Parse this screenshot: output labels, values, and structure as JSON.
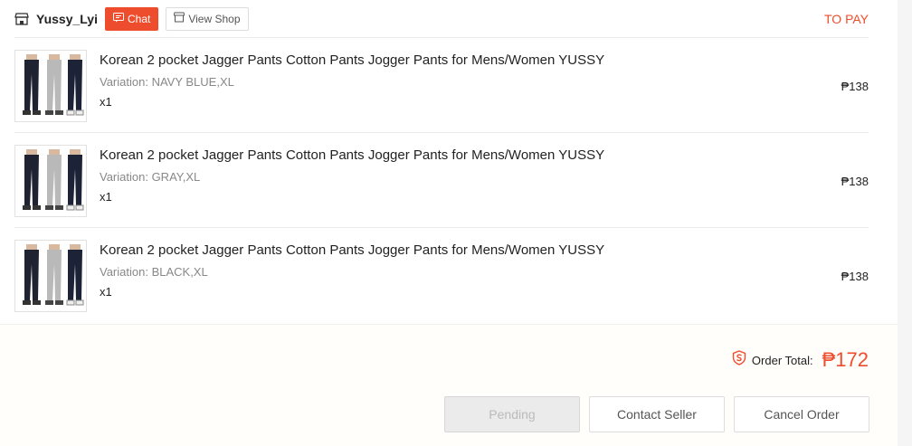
{
  "header": {
    "shop_name": "Yussy_Lyi",
    "chat_label": "Chat",
    "view_shop_label": "View Shop",
    "status": "TO PAY"
  },
  "items": [
    {
      "title": "Korean 2 pocket Jagger Pants Cotton Pants Jogger Pants for Mens/Women YUSSY",
      "variation": "Variation: NAVY BLUE,XL",
      "qty": "x1",
      "price": "₱138"
    },
    {
      "title": "Korean 2 pocket Jagger Pants Cotton Pants Jogger Pants for Mens/Women YUSSY",
      "variation": "Variation: GRAY,XL",
      "qty": "x1",
      "price": "₱138"
    },
    {
      "title": "Korean 2 pocket Jagger Pants Cotton Pants Jogger Pants for Mens/Women YUSSY",
      "variation": "Variation: BLACK,XL",
      "qty": "x1",
      "price": "₱138"
    }
  ],
  "footer": {
    "order_total_label": "Order Total:",
    "order_total_value": "₱172",
    "pending_label": "Pending",
    "contact_label": "Contact Seller",
    "cancel_label": "Cancel Order"
  },
  "colors": {
    "accent": "#ee4d2d",
    "pending_bg": "#ebebeb"
  },
  "icons": [
    "shop-icon",
    "chat-icon",
    "view-shop-icon",
    "shield-icon"
  ]
}
